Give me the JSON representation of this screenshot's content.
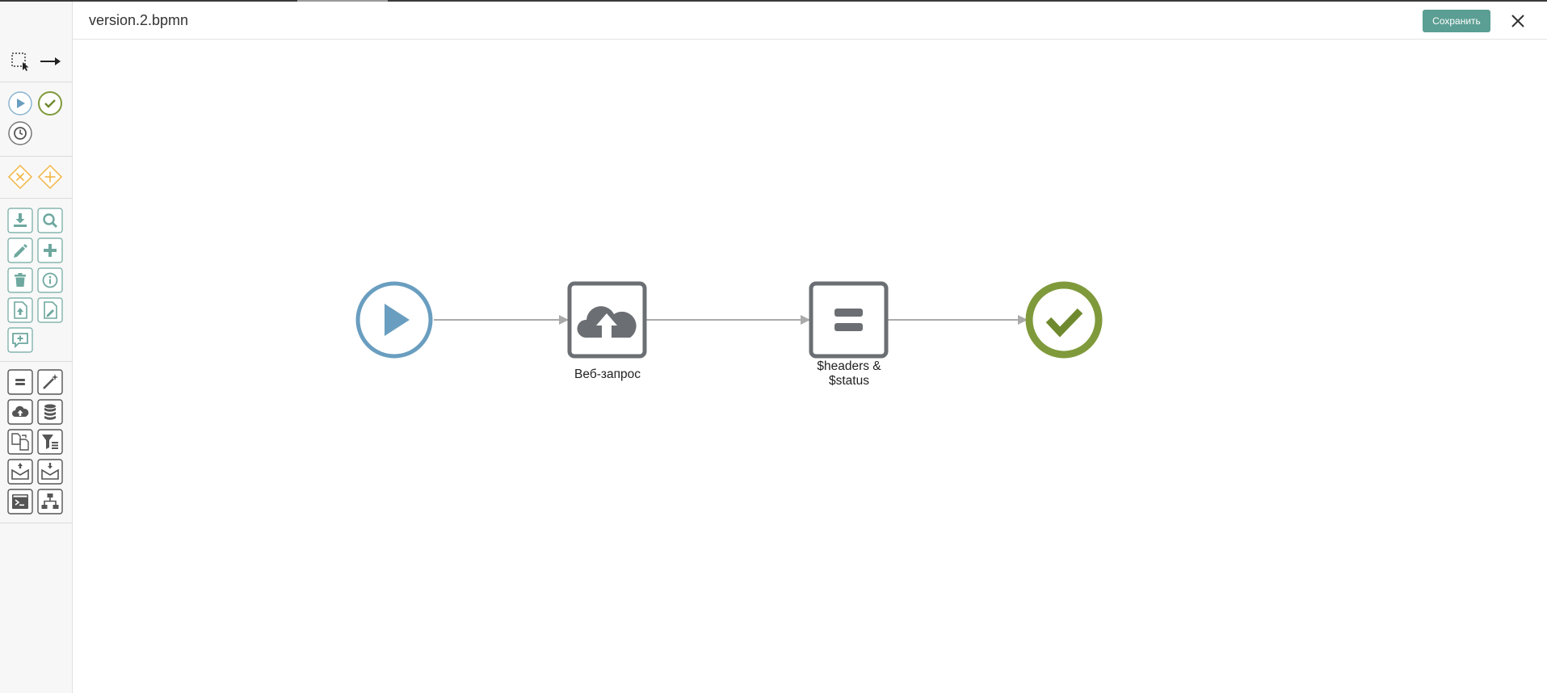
{
  "header": {
    "file_title": "version.2.bpmn",
    "save_label": "Сохранить"
  },
  "diagram": {
    "nodes": [
      {
        "id": "start-event",
        "type": "start-event",
        "label": ""
      },
      {
        "id": "web-request-task",
        "type": "service-task",
        "label": "Веб-запрос"
      },
      {
        "id": "headers-status-task",
        "type": "script-task",
        "label_line1": "$headers &",
        "label_line2": "$status"
      },
      {
        "id": "end-event",
        "type": "end-event",
        "label": ""
      }
    ],
    "flows": [
      {
        "from": "start-event",
        "to": "web-request-task"
      },
      {
        "from": "web-request-task",
        "to": "headers-status-task"
      },
      {
        "from": "headers-status-task",
        "to": "end-event"
      }
    ]
  },
  "palette": {
    "groups": [
      {
        "name": "tools",
        "items": [
          "lasso-tool-icon",
          "connect-arrow-icon"
        ]
      },
      {
        "name": "events",
        "items": [
          "start-event-icon",
          "end-event-icon",
          "timer-event-icon"
        ]
      },
      {
        "name": "gateways",
        "items": [
          "exclusive-gateway-icon",
          "parallel-gateway-icon"
        ]
      },
      {
        "name": "data-actions",
        "items": [
          "download-icon",
          "search-icon",
          "edit-icon",
          "add-icon",
          "delete-icon",
          "info-icon",
          "upload-document-icon",
          "edit-document-icon",
          "comment-icon"
        ]
      },
      {
        "name": "tasks",
        "items": [
          "script-task-icon",
          "magic-wand-icon",
          "web-request-icon",
          "database-icon",
          "transform-document-icon",
          "filter-icon",
          "send-mail-icon",
          "receive-mail-icon",
          "terminal-icon",
          "subprocess-icon"
        ]
      }
    ]
  },
  "colors": {
    "accent": "#5b9e93",
    "start_event": "#6a9ec0",
    "end_event": "#7f9a3b",
    "task_border": "#6b6f73",
    "gateway": "#f2b544",
    "flow": "#aaaaaa",
    "palette_teal": "#6ea89f"
  }
}
